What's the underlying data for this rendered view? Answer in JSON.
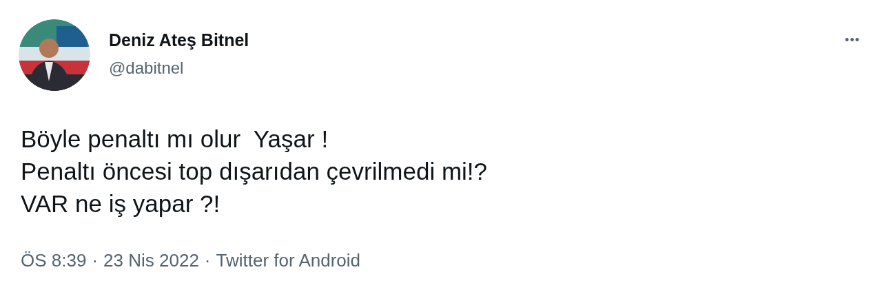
{
  "author": {
    "name": "Deniz Ateş Bitnel",
    "handle": "@dabitnel"
  },
  "more_button": "•••",
  "text_lines": [
    "Böyle penaltı mı olur  Yaşar !",
    "Penaltı öncesi top dışarıdan çevrilmedi mi!?",
    "VAR ne iş yapar ?!"
  ],
  "meta": {
    "time": "ÖS 8:39",
    "separator_1": "·",
    "date": "23 Nis 2022",
    "separator_2": "·",
    "source": "Twitter for Android"
  }
}
